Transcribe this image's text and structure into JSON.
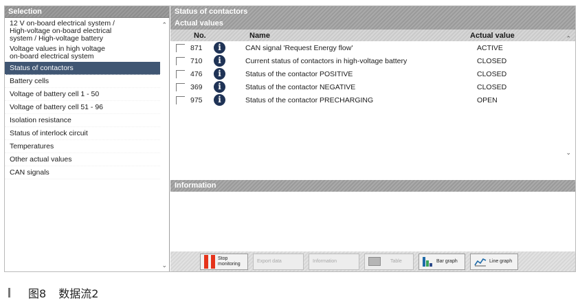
{
  "left_panel": {
    "title": "Selection",
    "items": [
      {
        "label": "12 V on-board electrical system / High-voltage on-board electrical system / High-voltage battery",
        "lines": [
          "12 V on-board electrical system /",
          "High-voltage on-board electrical",
          "system / High-voltage battery"
        ],
        "active": false
      },
      {
        "label": "Voltage values in high voltage on-board electrical system",
        "lines": [
          "Voltage values in high voltage",
          "on-board electrical system"
        ],
        "active": false
      },
      {
        "label": "Status of contactors",
        "lines": [
          "Status of contactors"
        ],
        "active": true
      },
      {
        "label": "Battery cells",
        "lines": [
          "Battery cells"
        ],
        "active": false
      },
      {
        "label": "Voltage of battery cell 1 - 50",
        "lines": [
          "Voltage of battery cell 1 - 50"
        ],
        "active": false
      },
      {
        "label": "Voltage of battery cell 51 - 96",
        "lines": [
          "Voltage of battery cell 51 - 96"
        ],
        "active": false
      },
      {
        "label": "Isolation resistance",
        "lines": [
          "Isolation resistance"
        ],
        "active": false
      },
      {
        "label": "Status of interlock circuit",
        "lines": [
          "Status of interlock circuit"
        ],
        "active": false
      },
      {
        "label": "Temperatures",
        "lines": [
          "Temperatures"
        ],
        "active": false
      },
      {
        "label": "Other actual values",
        "lines": [
          "Other actual values"
        ],
        "active": false
      },
      {
        "label": "CAN signals",
        "lines": [
          "CAN signals"
        ],
        "active": false
      }
    ]
  },
  "right_panel": {
    "title": "Status of contactors",
    "subtitle": "Actual values",
    "columns": {
      "no": "No.",
      "name": "Name",
      "value": "Actual value"
    },
    "rows": [
      {
        "no": "871",
        "name": "CAN signal 'Request Energy flow'",
        "value": "ACTIVE"
      },
      {
        "no": "710",
        "name": "Current status of contactors in high-voltage battery",
        "value": "CLOSED"
      },
      {
        "no": "476",
        "name": "Status of the contactor POSITIVE",
        "value": "CLOSED"
      },
      {
        "no": "369",
        "name": "Status of the contactor NEGATIVE",
        "value": "CLOSED"
      },
      {
        "no": "975",
        "name": "Status of the contactor PRECHARGING",
        "value": "OPEN"
      }
    ],
    "info_title": "Information"
  },
  "toolbar": {
    "stop": "Stop monitoring",
    "export": "Export data",
    "information": "Information",
    "table": "Table",
    "bar_graph": "Bar graph",
    "line_graph": "Line graph"
  },
  "caption": {
    "figure": "图8",
    "text": "数据流2"
  },
  "icons": {
    "info": "info-icon",
    "stop": "stop-icon",
    "table": "table-icon",
    "bar": "bar-graph-icon",
    "line": "line-graph-icon"
  },
  "colors": {
    "selected": "#405673",
    "info_icon": "#1f3356",
    "stop": "#e5331b"
  }
}
